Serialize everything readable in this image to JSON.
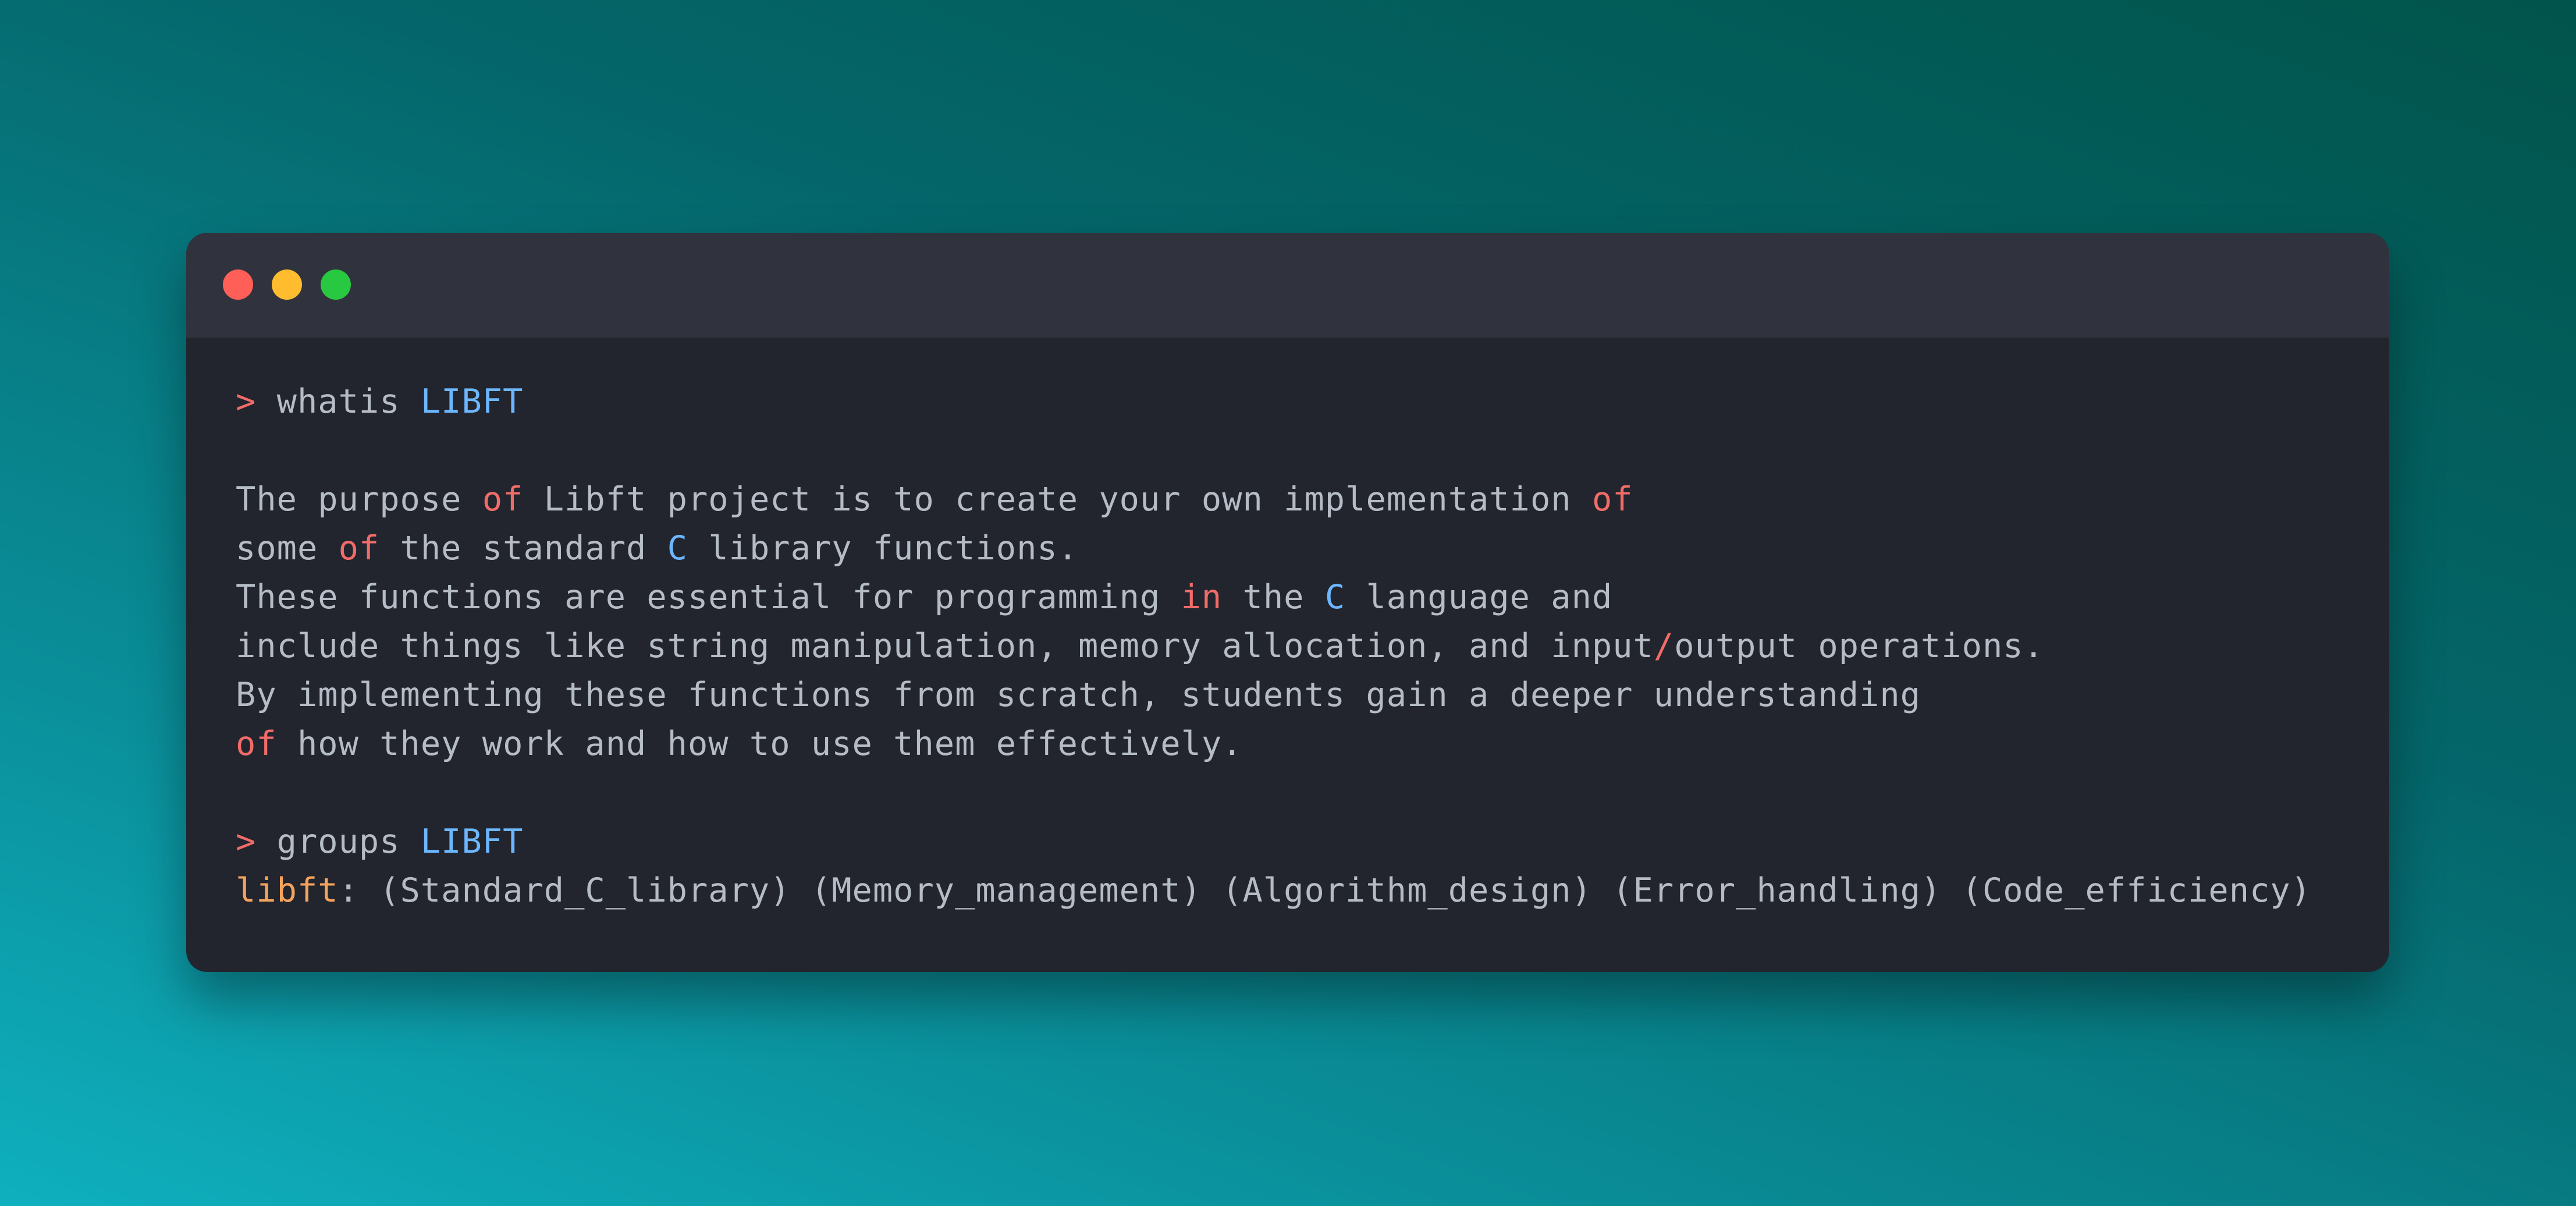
{
  "window": {
    "dots": [
      {
        "name": "close",
        "color": "#ff5f57"
      },
      {
        "name": "minimize",
        "color": "#febc2e"
      },
      {
        "name": "maximize",
        "color": "#28c840"
      }
    ]
  },
  "colors": {
    "prompt": "#f16c69",
    "keyword": "#f16c69",
    "highlight": "#6cb6ff",
    "label": "#f4a35c",
    "text": "#b6bcc6"
  },
  "terminal": {
    "lines": [
      [
        {
          "t": "> ",
          "c": "prompt"
        },
        {
          "t": "whatis ",
          "c": "text"
        },
        {
          "t": "LIBFT",
          "c": "highlight"
        }
      ],
      [],
      [
        {
          "t": "The purpose ",
          "c": "text"
        },
        {
          "t": "of",
          "c": "keyword"
        },
        {
          "t": " Libft project is to create your own implementation ",
          "c": "text"
        },
        {
          "t": "of",
          "c": "keyword"
        }
      ],
      [
        {
          "t": "some ",
          "c": "text"
        },
        {
          "t": "of",
          "c": "keyword"
        },
        {
          "t": " the standard ",
          "c": "text"
        },
        {
          "t": "C",
          "c": "highlight"
        },
        {
          "t": " library functions.",
          "c": "text"
        }
      ],
      [
        {
          "t": "These functions are essential for programming ",
          "c": "text"
        },
        {
          "t": "in",
          "c": "keyword"
        },
        {
          "t": " the ",
          "c": "text"
        },
        {
          "t": "C",
          "c": "highlight"
        },
        {
          "t": " language and",
          "c": "text"
        }
      ],
      [
        {
          "t": "include things like string manipulation, memory allocation, and input",
          "c": "text"
        },
        {
          "t": "/",
          "c": "keyword"
        },
        {
          "t": "output operations.",
          "c": "text"
        }
      ],
      [
        {
          "t": "By implementing these functions from scratch, students gain a deeper understanding",
          "c": "text"
        }
      ],
      [
        {
          "t": "of",
          "c": "keyword"
        },
        {
          "t": " how they work and how to use them effectively.",
          "c": "text"
        }
      ],
      [],
      [
        {
          "t": "> ",
          "c": "prompt"
        },
        {
          "t": "groups ",
          "c": "text"
        },
        {
          "t": "LIBFT",
          "c": "highlight"
        }
      ],
      [
        {
          "t": "libft",
          "c": "label"
        },
        {
          "t": ": (Standard_C_library) (Memory_management) (Algorithm_design) (Error_handling) (Code_efficiency)",
          "c": "text"
        }
      ]
    ]
  }
}
